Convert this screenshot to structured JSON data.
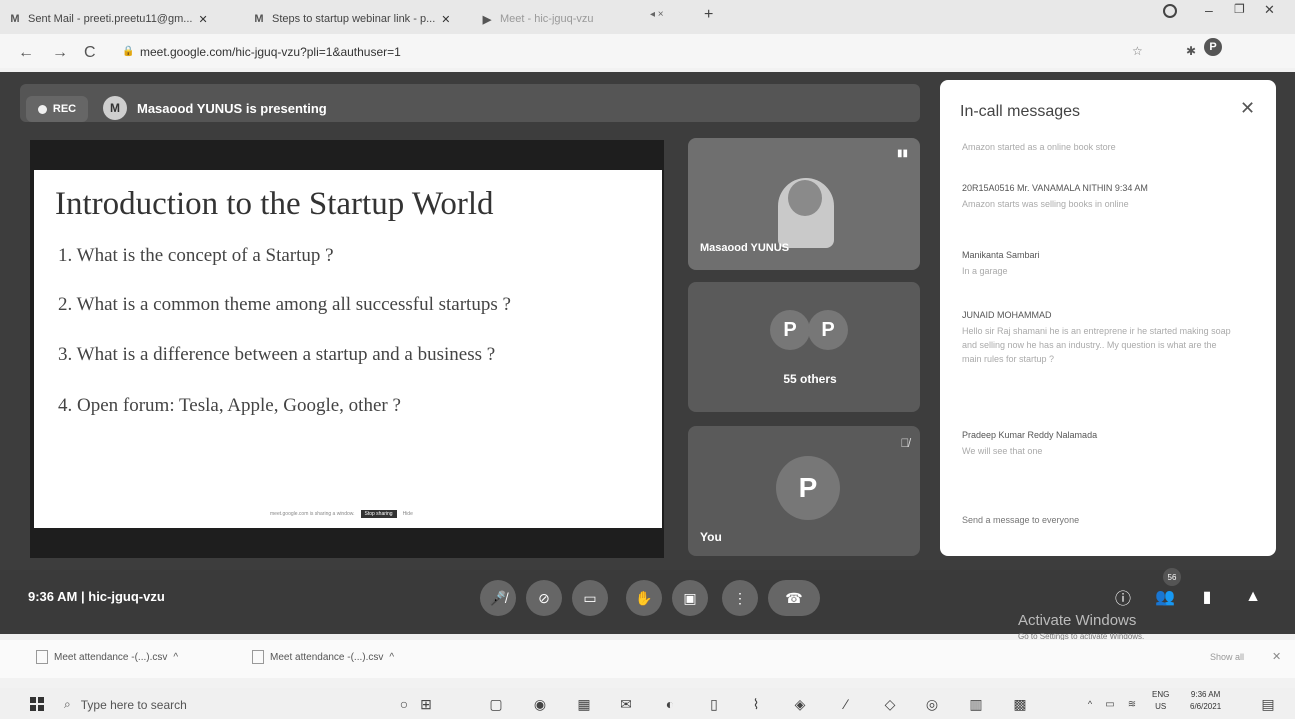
{
  "browser": {
    "tabs": [
      {
        "icon": "M",
        "label": "Sent Mail - preeti.preetu11@gm...",
        "close": "✕"
      },
      {
        "icon": "M",
        "label": "Steps to startup webinar link - p...",
        "close": "✕"
      },
      {
        "icon": "▶",
        "label": "Meet - hic-jguq-vzu",
        "close": ""
      }
    ],
    "new_tab": "+",
    "window_controls": [
      "–",
      "❐",
      "✕"
    ],
    "url": "meet.google.com/hic-jguq-vzu?pli=1&authuser=1",
    "profile_letter": "P"
  },
  "meet": {
    "rec_label": "REC",
    "presenting_text": "Masaood YUNUS is presenting",
    "presenter_initial": "M",
    "slide": {
      "title": "Introduction to the Startup World",
      "items": [
        "1.  What is the concept of a Startup ?",
        "2.  What is a common theme among all successful startups ?",
        "3.  What is a difference between a startup and a business ?",
        "4.  Open forum: Tesla, Apple, Google, other ?"
      ],
      "share_notice": "meet.google.com is sharing a window.",
      "stop_sharing": "Stop sharing",
      "hide": "Hide"
    },
    "tiles": {
      "video_name": "Masaood YUNUS",
      "others_letters": [
        "P",
        "P"
      ],
      "others_label": "55 others",
      "you_letter": "P",
      "you_label": "You"
    },
    "meeting_time": "9:36 AM",
    "meeting_code": "hic-jguq-vzu",
    "participants_count": "56",
    "panel": {
      "title": "In-call messages",
      "messages": [
        {
          "sender": "",
          "text": "Amazon started as a online book store"
        },
        {
          "sender": "20R15A0516 Mr. VANAMALA NITHIN  9:34 AM",
          "text": "Amazon starts was selling books in online"
        },
        {
          "sender": "Manikanta Sambari",
          "text": "In a garage"
        },
        {
          "sender": "JUNAID MOHAMMAD",
          "text": "Hello sir Raj shamani he is an entreprene ir he started making soap and selling now he has an industry.. My question is what are the main rules for startup ?"
        },
        {
          "sender": "Pradeep Kumar Reddy Nalamada",
          "text": "We will see that one"
        }
      ],
      "input_placeholder": "Send a message to everyone"
    },
    "activate_windows": "Activate Windows",
    "activate_windows_sub": "Go to Settings to activate Windows."
  },
  "downloads": {
    "items": [
      "Meet attendance -(...).csv",
      "Meet attendance -(...).csv"
    ],
    "show_all": "Show all"
  },
  "taskbar": {
    "search_placeholder": "Type here to search",
    "lang_line1": "ENG",
    "lang_line2": "US",
    "time": "9:36 AM",
    "date": "6/6/2021"
  }
}
